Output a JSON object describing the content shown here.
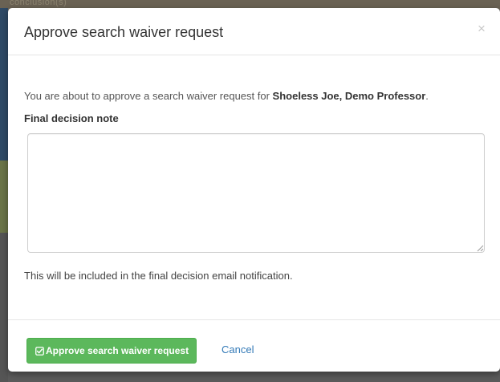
{
  "background": {
    "top_text": "conclusion(s)"
  },
  "modal": {
    "title": "Approve search waiver request",
    "close_label": "×",
    "intro_prefix": "You are about to approve a search waiver request for ",
    "intro_name": "Shoeless Joe, Demo Professor",
    "intro_suffix": ".",
    "field_label": "Final decision note",
    "note_value": "",
    "help_text": "This will be included in the final decision email notification.",
    "approve_label": "Approve search waiver request",
    "cancel_label": "Cancel"
  },
  "icons": {
    "close": "close-icon",
    "approve": "check-square-icon",
    "resize": "resize-grip-icon"
  },
  "colors": {
    "primary_button": "#5cb85c",
    "link": "#337ab7",
    "title_text": "#333333"
  }
}
